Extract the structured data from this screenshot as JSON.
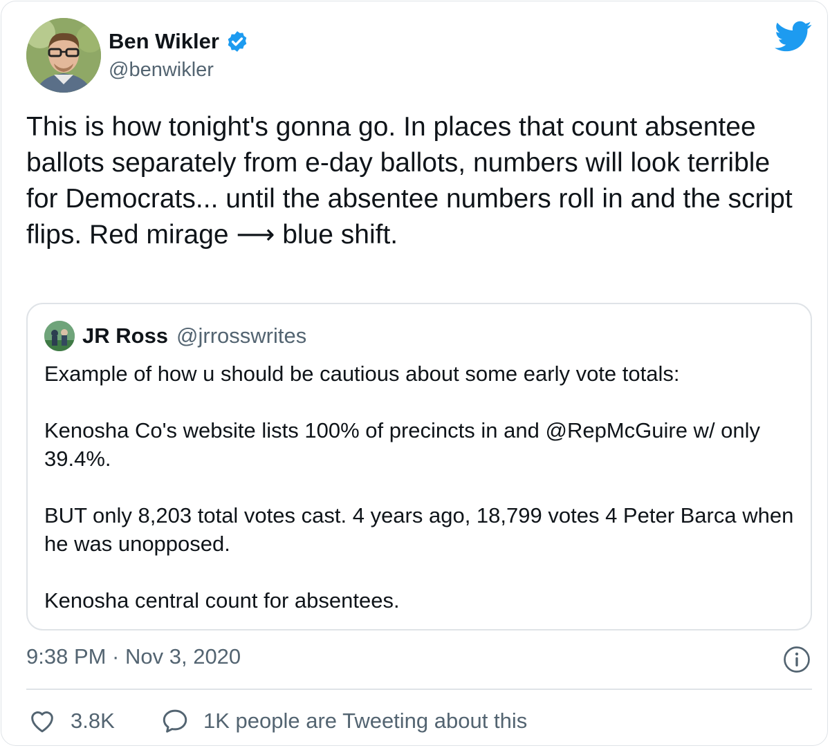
{
  "tweet": {
    "author": {
      "display_name": "Ben Wikler",
      "handle": "@benwikler",
      "verified": true,
      "avatar_icon": "profile-photo"
    },
    "text": "This is how tonight's gonna go. In places that count absentee ballots separately from e-day ballots, numbers will look terrible for Democrats... until the absentee numbers roll in and the script flips. Red mirage ⟶ blue shift.",
    "timestamp": "9:38 PM · Nov 3, 2020",
    "likes": "3.8K",
    "conversation": "1K people are Tweeting about this"
  },
  "quoted_tweet": {
    "author": {
      "display_name": "JR Ross",
      "handle": "@jrrosswrites",
      "avatar_icon": "profile-photo"
    },
    "paragraphs": [
      "Example of how u should be cautious about some early vote totals:",
      "Kenosha Co's website lists 100% of precincts in and @RepMcGuire w/ only 39.4%.",
      "BUT only 8,203 total votes cast. 4 years ago, 18,799 votes 4 Peter Barca when he was unopposed.",
      "Kenosha central count for absentees."
    ]
  },
  "icons": {
    "brand": "twitter-bird-icon",
    "verified": "verified-badge-icon",
    "info": "info-icon",
    "like": "heart-icon",
    "conversation": "speech-bubble-icon"
  },
  "colors": {
    "brand_blue": "#1d9bf0",
    "text_primary": "#0f1419",
    "text_secondary": "#536471",
    "border": "#dfe3e7"
  }
}
